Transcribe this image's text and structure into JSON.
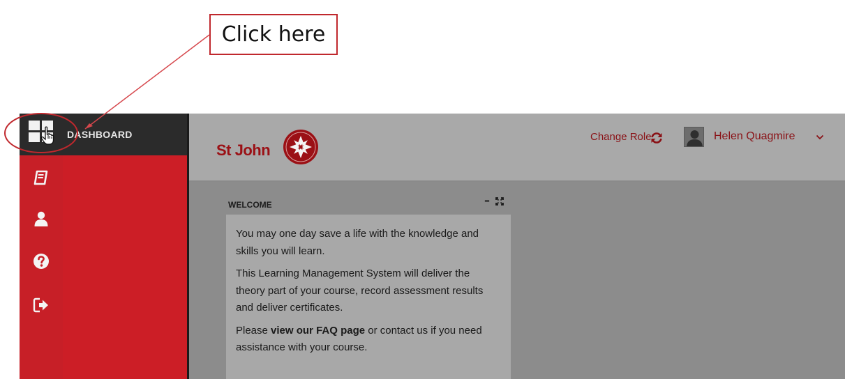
{
  "callout": {
    "text": "Click here"
  },
  "sidebar": {
    "dashboard_label": "DASHBOARD",
    "items": [
      {
        "icon": "grid-icon"
      },
      {
        "icon": "book-icon"
      },
      {
        "icon": "user-icon"
      },
      {
        "icon": "help-icon"
      },
      {
        "icon": "logout-icon"
      }
    ]
  },
  "header": {
    "logo_text": "St John",
    "change_role": "Change Role",
    "user_name": "Helen Quagmire"
  },
  "widget": {
    "title": "WELCOME",
    "p1": "You may one day save a life with the knowledge and skills you will learn.",
    "p2": "This Learning Management System will deliver the theory part of your course, record assessment results and deliver certificates.",
    "p3_prefix": "Please ",
    "p3_link": "view our FAQ page",
    "p3_suffix": " or contact us if you need assistance with your course."
  },
  "colors": {
    "brand_red": "#c71f27",
    "dark_red_text": "#8a1116",
    "annotation_red": "#c0282d"
  }
}
